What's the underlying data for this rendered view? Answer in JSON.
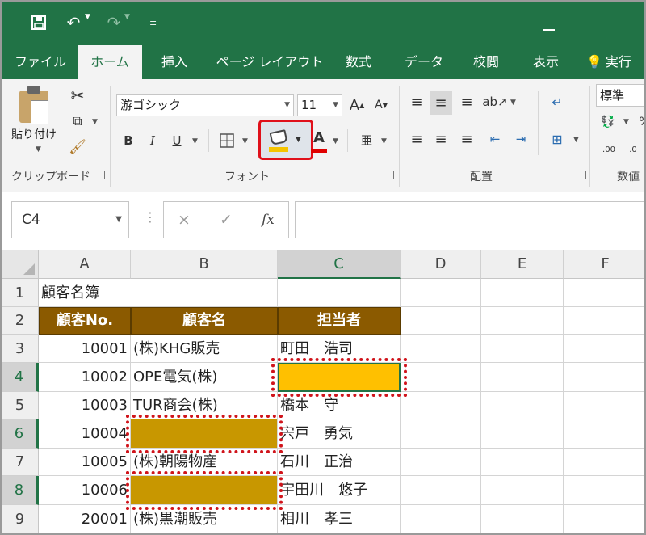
{
  "titlebar": {
    "save_icon": "save-icon",
    "undo_icon": "undo-icon",
    "redo_icon": "redo-icon",
    "customize_icon": "customize-qat-icon"
  },
  "tabs": [
    {
      "label": "ファイル"
    },
    {
      "label": "ホーム"
    },
    {
      "label": "挿入"
    },
    {
      "label": "ページ レイアウト"
    },
    {
      "label": "数式"
    },
    {
      "label": "データ"
    },
    {
      "label": "校閲"
    },
    {
      "label": "表示"
    },
    {
      "label": "実行"
    }
  ],
  "ribbon": {
    "clipboard": {
      "paste_label": "貼り付け",
      "group_label": "クリップボード"
    },
    "font": {
      "font_name": "游ゴシック",
      "font_size": "11",
      "bold": "B",
      "italic": "I",
      "underline": "U",
      "grow": "A",
      "shrink": "A",
      "font_color": "A",
      "phonetic": "亜",
      "group_label": "フォント",
      "fill_color": "#f5c400",
      "font_color_value": "#e00000"
    },
    "alignment": {
      "group_label": "配置"
    },
    "number": {
      "format": "標準",
      "group_label": "数値"
    }
  },
  "formula_bar": {
    "name_box": "C4",
    "cancel": "×",
    "enter": "✓",
    "fx": "fx",
    "formula": ""
  },
  "sheet": {
    "columns": [
      "A",
      "B",
      "C",
      "D",
      "E",
      "F"
    ],
    "rows": [
      "1",
      "2",
      "3",
      "4",
      "5",
      "6",
      "7",
      "8",
      "9"
    ],
    "selected_column": "C",
    "selected_rows": [
      "4",
      "6",
      "8"
    ],
    "cells": {
      "A1": "顧客名簿",
      "A2": "顧客No.",
      "B2": "顧客名",
      "C2": "担当者",
      "A3": "10001",
      "B3": "(株)KHG販売",
      "C3": "町田　浩司",
      "A4": "10002",
      "B4": "OPE電気(株)",
      "C4": "",
      "A5": "10003",
      "B5": "TUR商会(株)",
      "C5": "橋本　守",
      "A6": "10004",
      "B6": "",
      "C6": "宍戸　勇気",
      "A7": "10005",
      "B7": "(株)朝陽物産",
      "C7": "石川　正治",
      "A8": "10006",
      "B8": "",
      "C8": "宇田川　悠子",
      "A9": "20001",
      "B9": "(株)黒潮販売",
      "C9": "相川　孝三"
    },
    "colors": {
      "header_fill": "#8b5a00",
      "blank_fill_gold": "#c89700",
      "blank_fill_yellow": "#ffc000",
      "highlight_red": "#d0141b",
      "accent_green": "#217346"
    }
  }
}
